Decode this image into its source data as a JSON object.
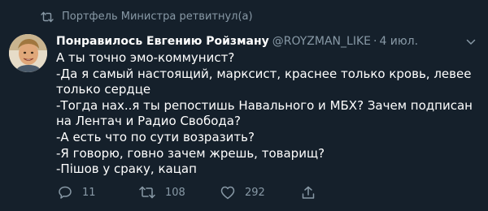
{
  "retweet": {
    "text": "Портфель Министра ретвитнул(а)"
  },
  "author": {
    "name": "Понравилось Евгению Ройзману",
    "handle": "@ROYZMAN_LIKE",
    "separator": "·",
    "timestamp": "4 июл."
  },
  "tweet": {
    "lines": [
      "А ты точно эмо-коммунист?",
      "-Да я самый настоящий, марксист, краснее только кровь, левее только сердце",
      "-Тогда нах..я ты репостишь Навального и МБХ? Зачем подписан на Лентач и Радио Свобода?",
      "-А есть что по сути возразить?",
      "-Я говорю, говно зачем жрешь, товарищ?",
      "-Пішов у сраку, кацап"
    ]
  },
  "actions": {
    "reply_count": "11",
    "retweet_count": "108",
    "like_count": "292"
  },
  "icons": {
    "retweet": "retweet-icon",
    "reply": "reply-icon",
    "like": "heart-icon",
    "share": "share-icon",
    "more": "chevron-down-icon"
  },
  "colors": {
    "background": "#15202b",
    "text": "#ffffff",
    "secondary": "#8899a6"
  }
}
